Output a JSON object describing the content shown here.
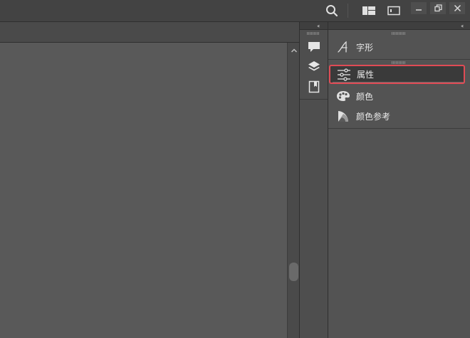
{
  "titlebar": {
    "icons": [
      "search-icon",
      "workspace-layout-icon",
      "screen-mode-icon"
    ],
    "window_controls": [
      "minimize-icon",
      "restore-icon",
      "close-icon"
    ]
  },
  "icon_strip": {
    "collapse_glyph": "‹‹",
    "icons": [
      "comment-icon",
      "layers-icon",
      "pages-icon"
    ]
  },
  "panel": {
    "collapse_glyph": "‹‹",
    "groups": [
      {
        "items": [
          {
            "icon": "glyph-icon",
            "label": "字形"
          }
        ]
      },
      {
        "items": [
          {
            "icon": "properties-icon",
            "label": "属性",
            "selected": true
          },
          {
            "icon": "color-icon",
            "label": "颜色"
          },
          {
            "icon": "color-guide-icon",
            "label": "颜色参考"
          }
        ]
      }
    ]
  },
  "colors": {
    "highlight": "#e04b55",
    "background": "#535353",
    "chrome": "#434343"
  }
}
